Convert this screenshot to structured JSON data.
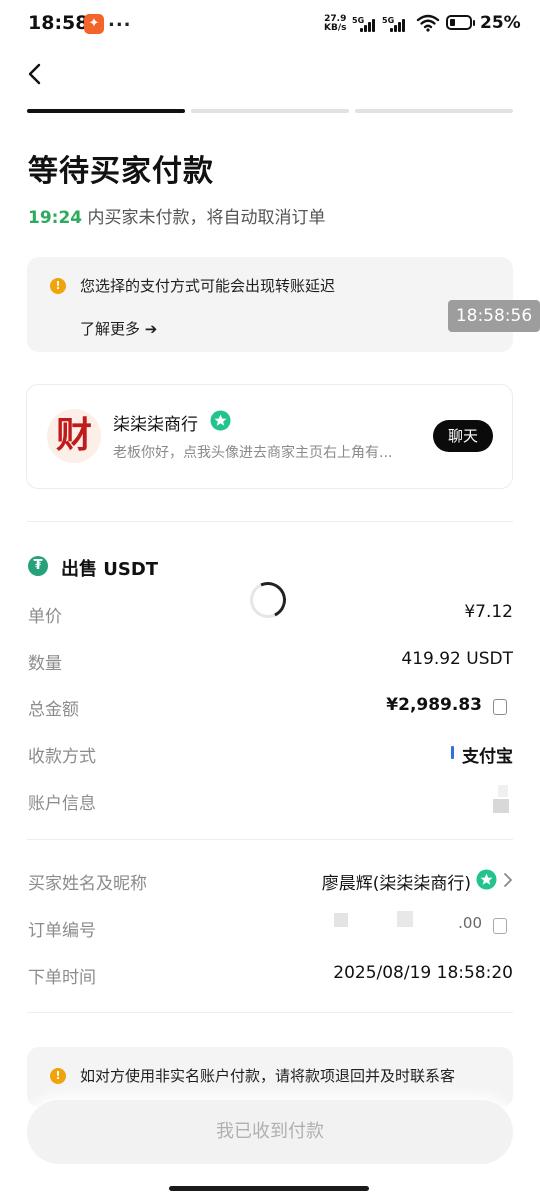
{
  "status_bar": {
    "time": "18:58",
    "net_speed_top": "27.9",
    "net_speed_bottom": "KB/s",
    "sig1": "5G",
    "sig2": "5G",
    "battery_pct": "25%",
    "battery_level": 0.25,
    "app_icon": "flame-app-icon",
    "more": "..."
  },
  "header": {
    "back_icon": "chevron-left-icon",
    "steps": {
      "total": 3,
      "active": 1
    }
  },
  "title": "等待买家付款",
  "countdown": {
    "time": "19:24",
    "text": " 内买家未付款，将自动取消订单"
  },
  "notice": {
    "icon": "!",
    "text": "您选择的支付方式可能会出现转账延迟",
    "link": "了解更多 ➔"
  },
  "overlay_time": "18:58:56",
  "merchant": {
    "avatar_text": "财",
    "name": "柒柒柒商行",
    "message": "老板你好，点我头像进去商家主页右上角有...",
    "chat_label": "聊天"
  },
  "trade": {
    "icon": "₮",
    "title": "出售 USDT",
    "rows": [
      {
        "label": "单价",
        "value": "¥7.12"
      },
      {
        "label": "数量",
        "value": "419.92 USDT"
      },
      {
        "label": "总金额",
        "value": "¥2,989.83"
      },
      {
        "label": "收款方式",
        "value": "支付宝"
      },
      {
        "label": "账户信息",
        "value": ""
      }
    ]
  },
  "order": {
    "rows": [
      {
        "label": "买家姓名及昵称",
        "value": "廖晨辉(柒柒柒商行)"
      },
      {
        "label": "订单编号",
        "value": ".00"
      },
      {
        "label": "下单时间",
        "value": "2025/08/19 18:58:20"
      }
    ]
  },
  "bottom_notice": {
    "icon": "!",
    "text": "如对方使用非实名账户付款，请将款项退回并及时联系客"
  },
  "confirm_button": "我已收到付款",
  "colors": {
    "accent_green": "#2eaa5c",
    "warn": "#f0a30a",
    "usdt": "#26a17b",
    "verified": "#22c38e"
  }
}
